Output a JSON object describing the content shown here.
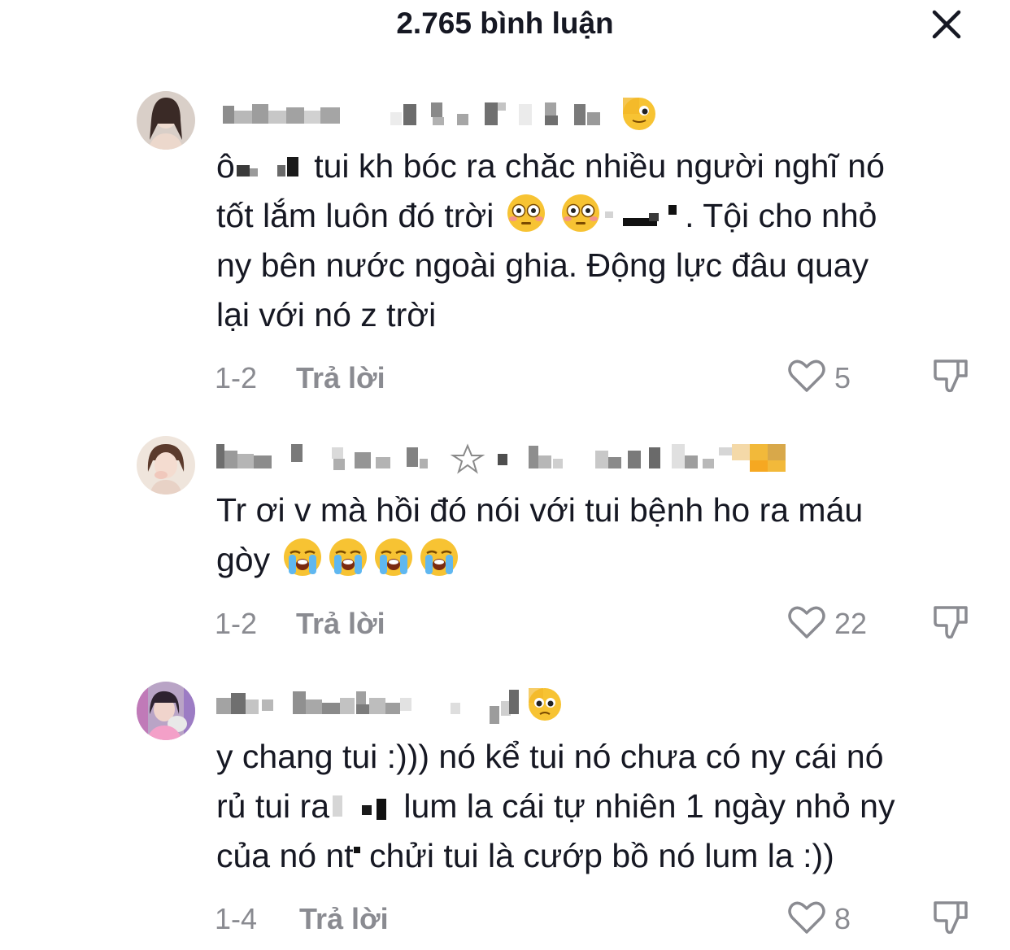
{
  "header": {
    "title": "2.765 bình luận",
    "close_icon": "close-icon"
  },
  "comments": [
    {
      "avatar_icon": "avatar-photo",
      "text_a": "ô",
      "text_b": " tui kh bóc ra chăc nhiều người nghĩ nó\ntốt lắm luôn đó trời ",
      "text_c": ". Tội cho nhỏ\nny bên nước ngoài ghia. Động lực đâu quay\nlại với nó z trời",
      "emojis": [
        "flushed-face",
        "flushed-face"
      ],
      "time": "1-2",
      "reply_label": "Trả lời",
      "likes": "5"
    },
    {
      "avatar_icon": "avatar-photo",
      "text_a": "Tr ơi v mà hồi đó nói với tui bệnh ho ra máu\ngòy ",
      "emojis": [
        "loudly-crying-face",
        "loudly-crying-face",
        "loudly-crying-face",
        "loudly-crying-face"
      ],
      "time": "1-2",
      "reply_label": "Trả lời",
      "likes": "22"
    },
    {
      "avatar_icon": "avatar-photo",
      "text_a": "y chang tui :))) nó kể tui nó chưa có ny cái nó\nrủ tui ra",
      "text_b": " lum la cái tự nhiên 1 ngày nhỏ ny\ncủa nó nt",
      "text_c": " chửi tui là cướp bồ nó lum la :))",
      "time": "1-4",
      "reply_label": "Trả lời",
      "likes": "8"
    }
  ],
  "colors": {
    "text": "#161823",
    "secondary": "#8a8b91",
    "emoji_yellow": "#f7c333"
  }
}
